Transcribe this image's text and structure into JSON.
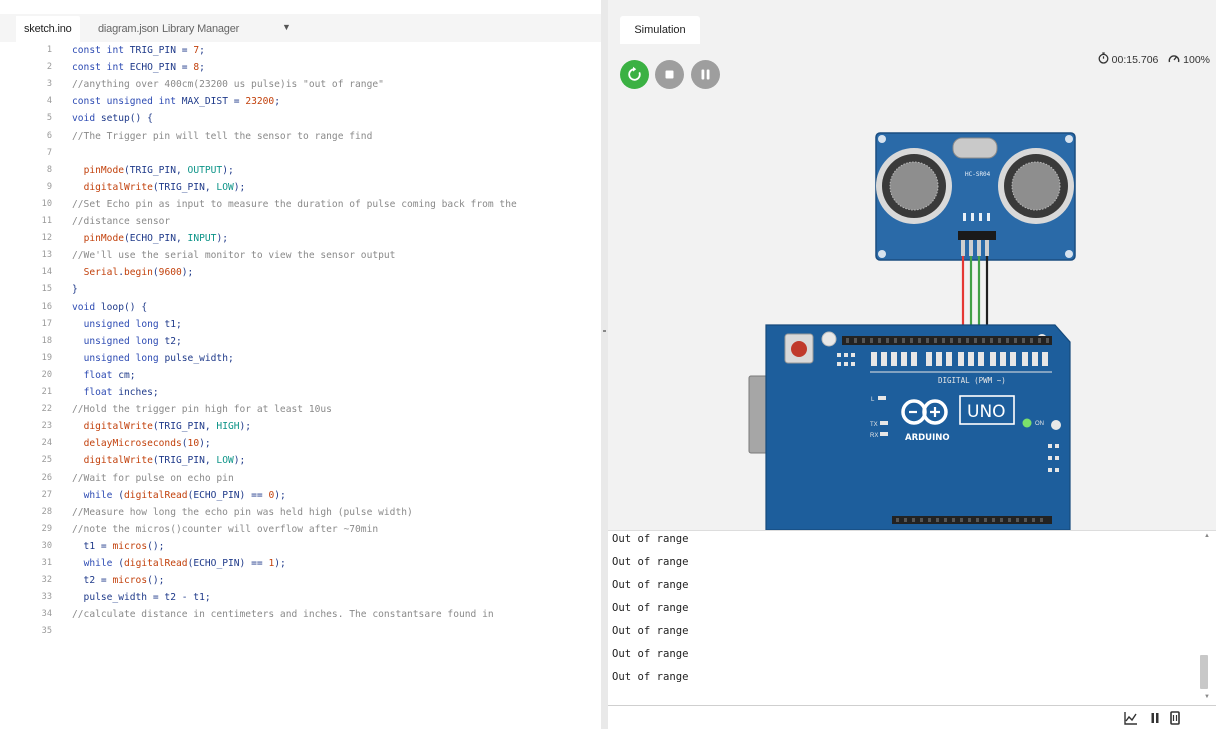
{
  "editor": {
    "tabs": [
      {
        "label": "sketch.ino",
        "active": true
      },
      {
        "label": "diagram.json",
        "active": false
      },
      {
        "label": "Library Manager",
        "active": false
      }
    ],
    "more_tabs_symbol": "▼",
    "lines": [
      {
        "n": "1",
        "text": "const int TRIG_PIN = 7;",
        "kind": "code"
      },
      {
        "n": "2",
        "text": "const int ECHO_PIN = 8;",
        "kind": "code"
      },
      {
        "n": "3",
        "text": "//anything over 400cm(23200 us pulse)is \"out of range\"",
        "kind": "comment"
      },
      {
        "n": "4",
        "text": "const unsigned int MAX_DIST = 23200;",
        "kind": "code"
      },
      {
        "n": "5",
        "text": "void setup() {",
        "kind": "code"
      },
      {
        "n": "6",
        "text": "//The Trigger pin will tell the sensor to range find",
        "kind": "comment"
      },
      {
        "n": "7",
        "text": "",
        "kind": "code"
      },
      {
        "n": "8",
        "text": "  pinMode(TRIG_PIN, OUTPUT);",
        "kind": "call"
      },
      {
        "n": "9",
        "text": "  digitalWrite(TRIG_PIN, LOW);",
        "kind": "call"
      },
      {
        "n": "10",
        "text": "//Set Echo pin as input to measure the duration of pulse coming back from the",
        "kind": "comment"
      },
      {
        "n": "11",
        "text": "//distance sensor",
        "kind": "comment"
      },
      {
        "n": "12",
        "text": "  pinMode(ECHO_PIN, INPUT);",
        "kind": "call"
      },
      {
        "n": "13",
        "text": "//We'll use the serial monitor to view the sensor output",
        "kind": "comment"
      },
      {
        "n": "14",
        "text": "  Serial.begin(9600);",
        "kind": "call"
      },
      {
        "n": "15",
        "text": "}",
        "kind": "code"
      },
      {
        "n": "16",
        "text": "void loop() {",
        "kind": "code"
      },
      {
        "n": "17",
        "text": "  unsigned long t1;",
        "kind": "code"
      },
      {
        "n": "18",
        "text": "  unsigned long t2;",
        "kind": "code"
      },
      {
        "n": "19",
        "text": "  unsigned long pulse_width;",
        "kind": "code"
      },
      {
        "n": "20",
        "text": "  float cm;",
        "kind": "code"
      },
      {
        "n": "21",
        "text": "  float inches;",
        "kind": "code"
      },
      {
        "n": "22",
        "text": "//Hold the trigger pin high for at least 10us",
        "kind": "comment"
      },
      {
        "n": "23",
        "text": "  digitalWrite(TRIG_PIN, HIGH);",
        "kind": "call"
      },
      {
        "n": "24",
        "text": "  delayMicroseconds(10);",
        "kind": "call"
      },
      {
        "n": "25",
        "text": "  digitalWrite(TRIG_PIN, LOW);",
        "kind": "call"
      },
      {
        "n": "26",
        "text": "//Wait for pulse on echo pin",
        "kind": "comment"
      },
      {
        "n": "27",
        "text": "  while (digitalRead(ECHO_PIN) == 0);",
        "kind": "call"
      },
      {
        "n": "28",
        "text": "//Measure how long the echo pin was held high (pulse width)",
        "kind": "comment"
      },
      {
        "n": "29",
        "text": "//note the micros()counter will overflow after ~70min",
        "kind": "comment"
      },
      {
        "n": "30",
        "text": "  t1 = micros();",
        "kind": "call"
      },
      {
        "n": "31",
        "text": "  while (digitalRead(ECHO_PIN) == 1);",
        "kind": "call"
      },
      {
        "n": "32",
        "text": "  t2 = micros();",
        "kind": "call"
      },
      {
        "n": "33",
        "text": "  pulse_width = t2 - t1;",
        "kind": "code"
      },
      {
        "n": "34",
        "text": "//calculate distance in centimeters and inches. The constantsare found in",
        "kind": "comment"
      },
      {
        "n": "35",
        "text": "",
        "kind": "code"
      }
    ]
  },
  "simulation": {
    "tab_label": "Simulation",
    "timer": "00:15.706",
    "speed": "100%",
    "controls": [
      "restart",
      "stop",
      "pause"
    ],
    "colors": {
      "restart": "#3bb143",
      "inactive": "#9e9e9e",
      "board": "#1d5e9c",
      "sensor": "#2a6aa8"
    },
    "sensor_label": "HC-SR04",
    "board_labels": {
      "brand": "ARDUINO",
      "model": "UNO",
      "digital": "DIGITAL (PWM ~)",
      "on": "ON",
      "tx": "TX",
      "rx": "RX",
      "l": "L"
    }
  },
  "serial_monitor": {
    "lines": [
      "Out of range",
      "Out of range",
      "Out of range",
      "Out of range",
      "Out of range",
      "Out of range",
      "Out of range"
    ],
    "input_placeholder": ""
  }
}
